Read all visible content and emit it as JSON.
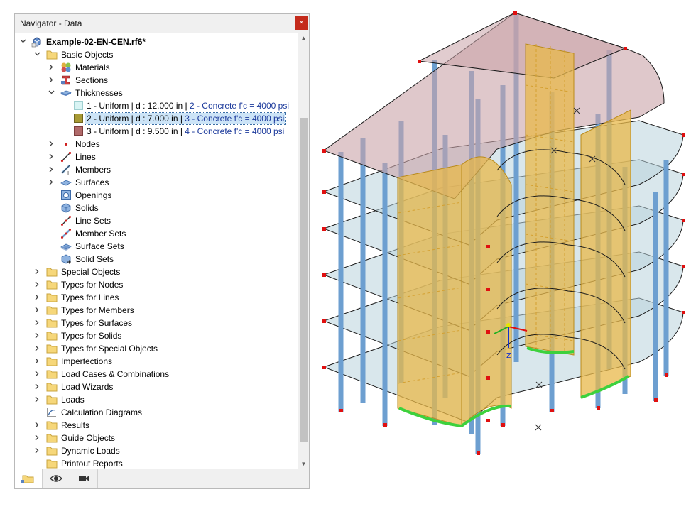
{
  "navigator": {
    "title": "Navigator - Data",
    "close": "×",
    "root": "Example-02-EN-CEN.rf6*",
    "basic_objects": "Basic Objects",
    "materials": "Materials",
    "sections": "Sections",
    "thicknesses": "Thicknesses",
    "thickness_items": [
      {
        "prefix": "1 - Uniform | d : 12.000 in | ",
        "material": "2 - Concrete f'c = 4000 psi",
        "color": "#d9f4f4"
      },
      {
        "prefix": "2 - Uniform | d : 7.000 in | ",
        "material": "3 - Concrete f'c = 4000 psi",
        "color": "#a89a34"
      },
      {
        "prefix": "3 - Uniform | d : 9.500 in | ",
        "material": "4 - Concrete f'c = 4000 psi",
        "color": "#b06a6a"
      }
    ],
    "basic_children": [
      "Nodes",
      "Lines",
      "Members",
      "Surfaces",
      "Openings",
      "Solids",
      "Line Sets",
      "Member Sets",
      "Surface Sets",
      "Solid Sets"
    ],
    "folders": [
      "Special Objects",
      "Types for Nodes",
      "Types for Lines",
      "Types for Members",
      "Types for Surfaces",
      "Types for Solids",
      "Types for Special Objects",
      "Imperfections",
      "Load Cases & Combinations",
      "Load Wizards",
      "Loads",
      "Calculation Diagrams",
      "Results",
      "Guide Objects",
      "Dynamic Loads",
      "Printout Reports"
    ]
  },
  "model_view": {
    "axis_label": "Z"
  },
  "colors": {
    "selection": "#cce4f7",
    "close_button": "#c42b1c",
    "wall": "#e8b84a",
    "column": "#6d9fd0",
    "slab": "#b9d3dc",
    "roof": "#c9a3a8",
    "node": "#e01010",
    "support": "#3dd13d"
  }
}
